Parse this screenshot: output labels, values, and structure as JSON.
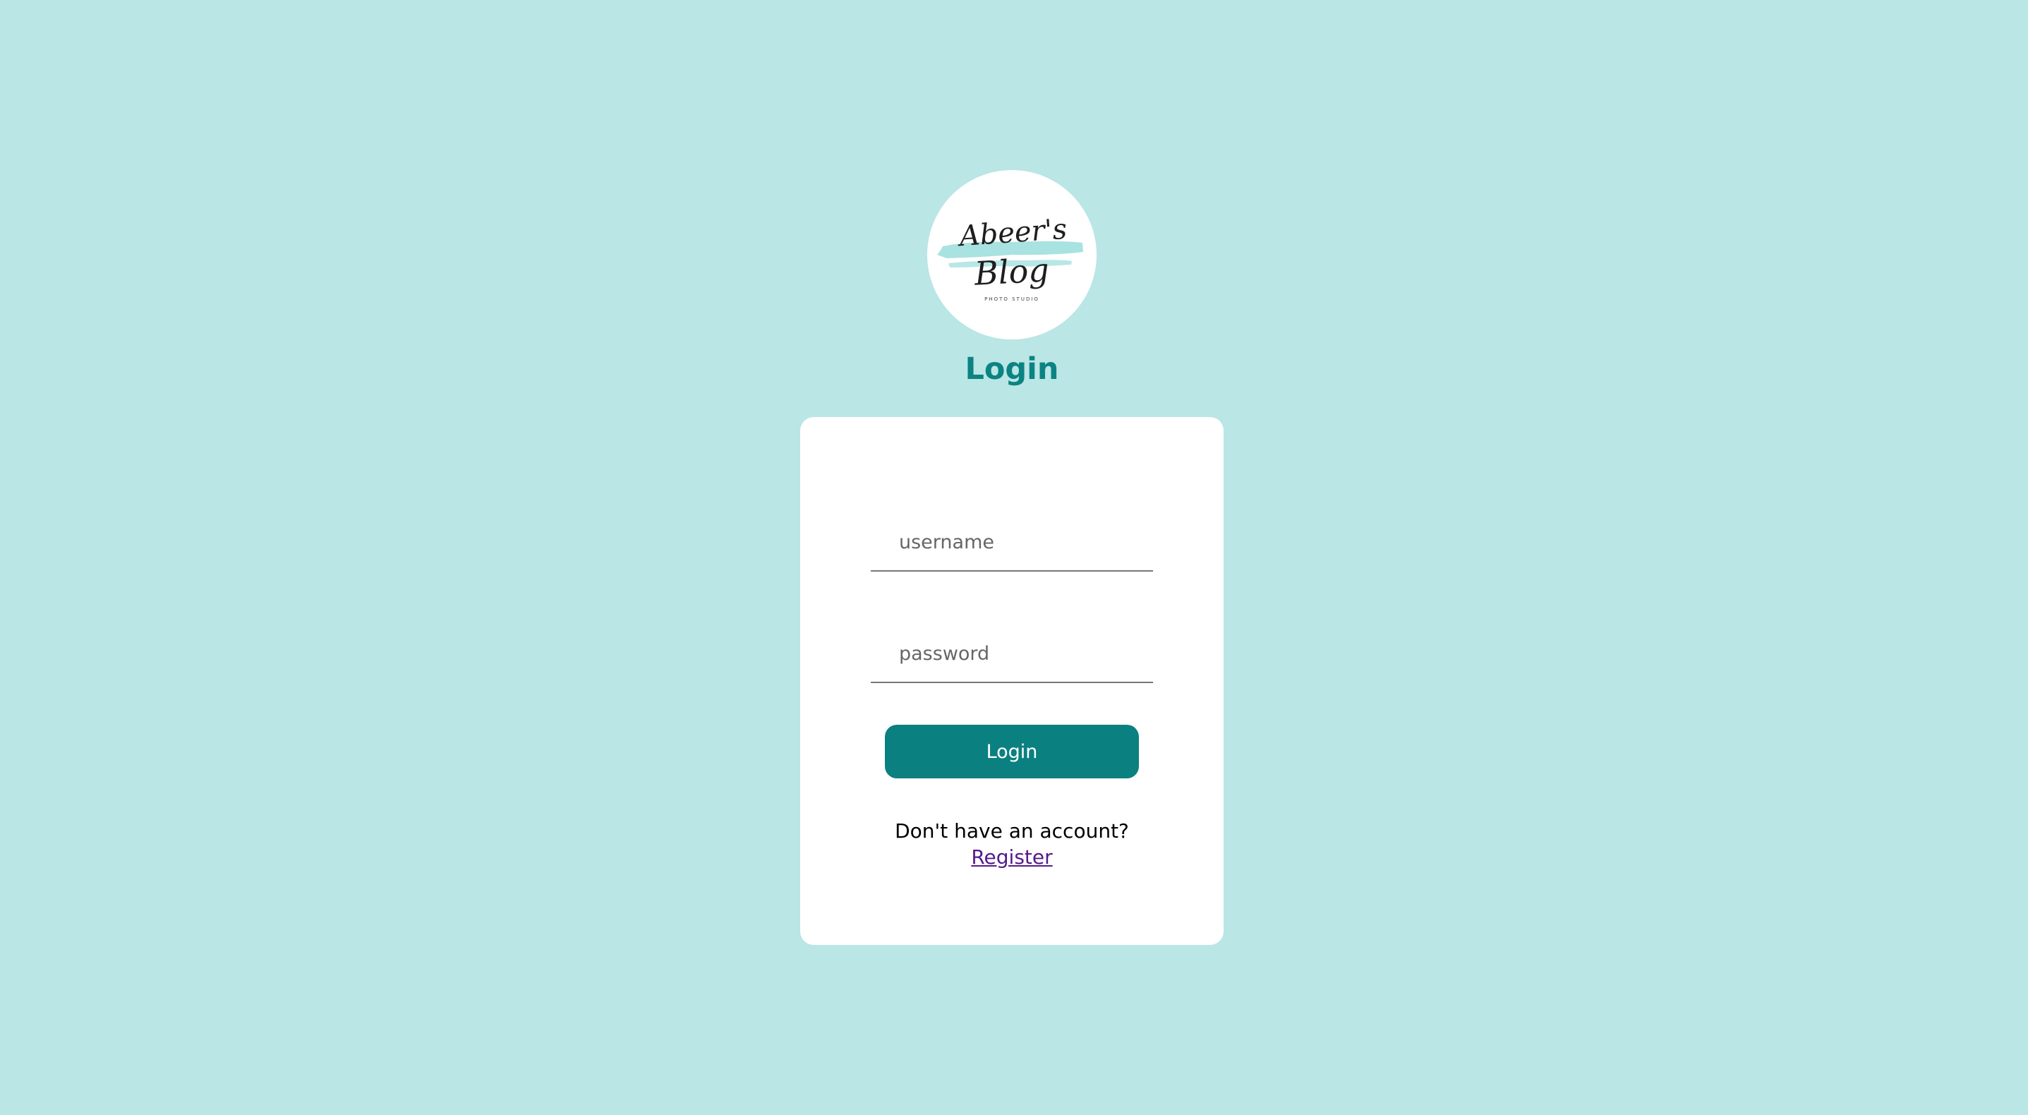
{
  "logo": {
    "line1": "Abeer's",
    "line2": "Blog",
    "tagline": "PHOTO STUDIO"
  },
  "page_title": "Login",
  "form": {
    "username_placeholder": "username",
    "username_value": "",
    "password_placeholder": "password",
    "password_value": "",
    "login_button_label": "Login"
  },
  "footer": {
    "prompt": "Don't have an account?",
    "register_label": "Register"
  },
  "colors": {
    "background": "#bae6e5",
    "accent": "#0b8080",
    "title": "#0b8383",
    "card": "#ffffff",
    "link": "#551a8b"
  }
}
